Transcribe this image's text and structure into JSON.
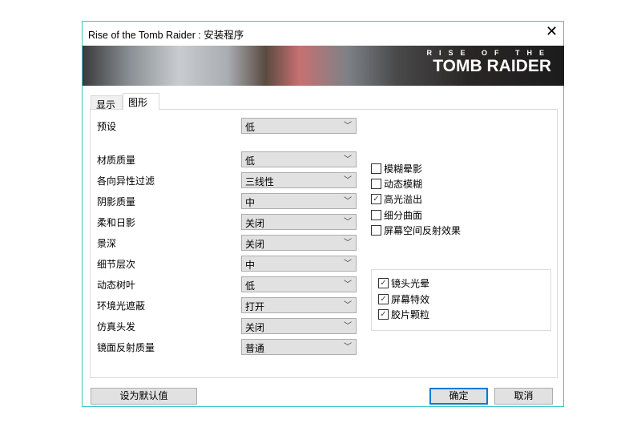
{
  "window": {
    "title": "Rise of the Tomb Raider : 安装程序",
    "close": "✕"
  },
  "banner": {
    "line1": "RISE OF THE",
    "line2": "TOMB RAIDER"
  },
  "tabs": [
    {
      "label": "显示"
    },
    {
      "label": "图形",
      "active": true
    }
  ],
  "preset": {
    "label": "预设",
    "value": "低"
  },
  "settings": [
    {
      "label": "材质质量",
      "value": "低"
    },
    {
      "label": "各向异性过滤",
      "value": "三线性"
    },
    {
      "label": "阴影质量",
      "value": "中"
    },
    {
      "label": "柔和日影",
      "value": "关闭"
    },
    {
      "label": "景深",
      "value": "关闭"
    },
    {
      "label": "细节层次",
      "value": "中"
    },
    {
      "label": "动态树叶",
      "value": "低"
    },
    {
      "label": "环境光遮蔽",
      "value": "打开"
    },
    {
      "label": "仿真头发",
      "value": "关闭"
    },
    {
      "label": "镜面反射质量",
      "value": "普通"
    }
  ],
  "checkboxes": [
    {
      "label": "模糊晕影",
      "checked": false
    },
    {
      "label": "动态模糊",
      "checked": false
    },
    {
      "label": "高光溢出",
      "checked": true
    },
    {
      "label": "细分曲面",
      "checked": false
    },
    {
      "label": "屏幕空间反射效果",
      "checked": false
    }
  ],
  "group_checkboxes": [
    {
      "label": "镜头光晕",
      "checked": true
    },
    {
      "label": "屏幕特效",
      "checked": true
    },
    {
      "label": "胶片颗粒",
      "checked": true
    }
  ],
  "buttons": {
    "default": "设为默认值",
    "ok": "确定",
    "cancel": "取消"
  },
  "colors": {
    "border": "#3cc8c8",
    "focus": "#0078d7"
  }
}
